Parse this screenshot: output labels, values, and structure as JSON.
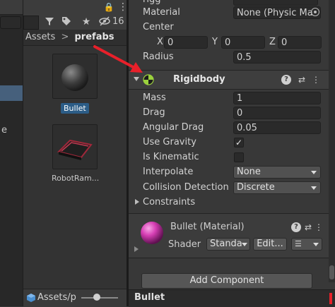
{
  "project": {
    "breadcrumb_root": "Assets",
    "breadcrumb_sep": ">",
    "breadcrumb_current": "prefabs",
    "toolbar_lock": "🔒",
    "hidden_count": "16",
    "assets": [
      {
        "label": "Bullet",
        "selected": true
      },
      {
        "label": "RobotRam..."
      }
    ],
    "bottom_path": "Assets/p"
  },
  "left_strip": {
    "partial_letter": "e"
  },
  "inspector": {
    "collider": {
      "partial_top_label": "rigg",
      "material_label": "Material",
      "material_value": "None (Physic Ma",
      "center_label": "Center",
      "center_x_label": "X",
      "center_x": "0",
      "center_y_label": "Y",
      "center_y": "0",
      "center_z_label": "Z",
      "center_z": "0",
      "radius_label": "Radius",
      "radius_value": "0.5"
    },
    "rigidbody": {
      "title": "Rigidbody",
      "mass_label": "Mass",
      "mass_value": "1",
      "drag_label": "Drag",
      "drag_value": "0",
      "angular_drag_label": "Angular Drag",
      "angular_drag_value": "0.05",
      "use_gravity_label": "Use Gravity",
      "use_gravity": true,
      "is_kinematic_label": "Is Kinematic",
      "is_kinematic": false,
      "interpolate_label": "Interpolate",
      "interpolate_value": "None",
      "collision_label": "Collision Detection",
      "collision_value": "Discrete",
      "constraints_label": "Constraints"
    },
    "material": {
      "title": "Bullet (Material)",
      "shader_label": "Shader",
      "shader_value": "Standa",
      "edit_label": "Edit..."
    },
    "add_component_label": "Add Component",
    "preview_title": "Bullet"
  },
  "colors": {
    "accent_arrow": "#e8202a",
    "selection": "#2c5d87",
    "material_sphere": "#d63fb4"
  }
}
